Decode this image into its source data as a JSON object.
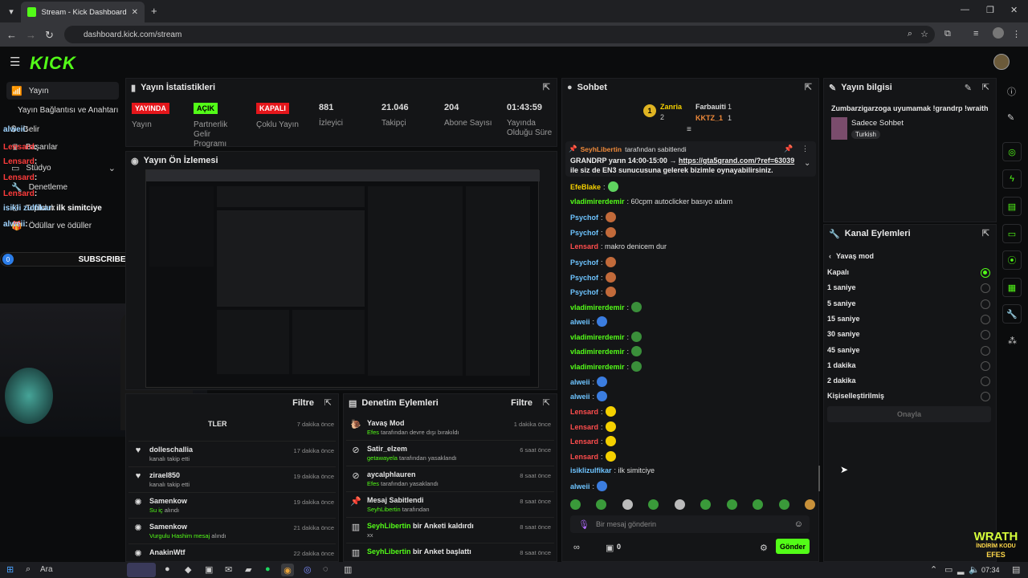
{
  "browser": {
    "tab_title": "Stream - Kick Dashboard",
    "url": "dashboard.kick.com/stream"
  },
  "kick": {
    "logo": "KICK"
  },
  "sidebar": {
    "items": [
      {
        "label": "Yayın"
      },
      {
        "label": "Yayın Bağlantısı ve Anahtarı"
      },
      {
        "label": "Gelir"
      },
      {
        "label": "Başarılar"
      },
      {
        "label": "Stüdyo"
      },
      {
        "label": "Denetleme"
      },
      {
        "label": "Topluluk"
      },
      {
        "label": "Ödüllar ve ödüller"
      }
    ]
  },
  "stats_panel": {
    "title": "Yayın İstatistikleri",
    "items": [
      {
        "badge": "YAYINDA",
        "label": "Yayın"
      },
      {
        "badge": "AÇIK",
        "label": "Partnerlik Gelir Programı"
      },
      {
        "badge": "KAPALI",
        "label": "Çoklu Yayın"
      },
      {
        "value": "881",
        "label": "İzleyici"
      },
      {
        "value": "21.046",
        "label": "Takipçi"
      },
      {
        "value": "204",
        "label": "Abone Sayısı"
      },
      {
        "value": "01:43:59",
        "label": "Yayında Olduğu Süre"
      }
    ]
  },
  "preview_panel": {
    "title": "Yayın Ön İzlemesi"
  },
  "overlay": {
    "subs_label": "SUBSCRIBERS",
    "subs_left": "0",
    "subs_right": "7",
    "chat_lines": [
      {
        "user": "alweii",
        "text": ":"
      },
      {
        "user": "Lensard",
        "text": ":"
      },
      {
        "user": "Lensard",
        "text": ":"
      },
      {
        "user": "Lensard",
        "text": ":"
      },
      {
        "user": "Lensard",
        "text": ":"
      },
      {
        "user": "isikli zulfikar",
        "text": ": ilk simitciye"
      },
      {
        "user": "alweii",
        "text": ":"
      }
    ]
  },
  "activity": {
    "filter": "Filtre",
    "header_cut": "TLER",
    "items": [
      {
        "time": "7 dakika önce"
      },
      {
        "title": "dolleschallia",
        "sub": "kanalı takip etti",
        "time": "17 dakika önce"
      },
      {
        "title": "zirael850",
        "sub": "kanalı takip etti",
        "time": "19 dakika önce"
      },
      {
        "title": "Samenkow",
        "sub_hl": "Su iç",
        "sub": "alındı",
        "time": "19 dakika önce"
      },
      {
        "title": "Samenkow",
        "sub_hl": "Vurgulu Hashim mesaj",
        "sub": "alındı",
        "time": "21 dakika önce"
      },
      {
        "title": "AnakinWtf",
        "time": "22 dakika önce"
      }
    ]
  },
  "mod_actions": {
    "title": "Denetim Eylemleri",
    "filter": "Filtre",
    "items": [
      {
        "title": "Yavaş Mod",
        "sub_hl": "Efes",
        "sub": "tarafından devre dışı bırakıldı",
        "time": "1 dakika önce"
      },
      {
        "title": "Satir_elzem",
        "sub_hl": "getawayela",
        "sub": "tarafından yasaklandı",
        "time": "6 saat önce"
      },
      {
        "title": "aycalphlauren",
        "sub_hl": "Efes",
        "sub": "tarafından yasaklandı",
        "time": "8 saat önce"
      },
      {
        "title": "Mesaj Sabitlendi",
        "sub_hl": "SeyhLibertin",
        "sub": "tarafından",
        "time": "8 saat önce"
      },
      {
        "title_hl": "SeyhLibertin",
        "title": "bir Anketi kaldırdı",
        "sub": "xx",
        "time": "8 saat önce"
      },
      {
        "title_hl": "SeyhLibertin",
        "title": "bir Anket başlattı",
        "time": "8 saat önce"
      }
    ]
  },
  "chat": {
    "title": "Sohbet",
    "leaders": [
      {
        "name": "Zanria",
        "count": "2"
      },
      {
        "name": "Farbauiti",
        "count": "1"
      },
      {
        "name": "KKTZ_1",
        "count": "1"
      }
    ],
    "pinned_by": "SeyhLibertin",
    "pinned_suffix": "tarafından sabitlendi",
    "pinned_text1": "GRANDRP yarın 14:00-15:00 →",
    "pinned_link": "https://gta5grand.com/?ref=63039",
    "pinned_text2": "ile siz de EN3 sunucusuna gelerek bizimle oynayabilirsiniz.",
    "messages": [
      {
        "user": "EfeBlake",
        "text": ":",
        "color": "#f5d000",
        "emo": "#5fd35f"
      },
      {
        "user": "vladimirerdemir",
        "text": ": 60cpm autoclicker basıyo adam",
        "color": "#53fc18",
        "emo": ""
      },
      {
        "user": "Psychof",
        "text": ":",
        "color": "#6ec4ff",
        "emo": "#c26a3a"
      },
      {
        "user": "Psychof",
        "text": ":",
        "color": "#6ec4ff",
        "emo": "#c26a3a"
      },
      {
        "user": "Lensard",
        "text": ": makro denicem dur",
        "color": "#ff4d4d",
        "emo": ""
      },
      {
        "user": "Psychof",
        "text": ":",
        "color": "#6ec4ff",
        "emo": "#c26a3a"
      },
      {
        "user": "Psychof",
        "text": ":",
        "color": "#6ec4ff",
        "emo": "#c26a3a"
      },
      {
        "user": "Psychof",
        "text": ":",
        "color": "#6ec4ff",
        "emo": "#c26a3a"
      },
      {
        "user": "vladimirerdemir",
        "text": ":",
        "color": "#53fc18",
        "emo": "#3a8f3a"
      },
      {
        "user": "alweii",
        "text": ":",
        "color": "#6ec4ff",
        "emo": "#3b7de0"
      },
      {
        "user": "vladimirerdemir",
        "text": ":",
        "color": "#53fc18",
        "emo": "#3a8f3a"
      },
      {
        "user": "vladimirerdemir",
        "text": ":",
        "color": "#53fc18",
        "emo": "#3a8f3a"
      },
      {
        "user": "vladimirerdemir",
        "text": ":",
        "color": "#53fc18",
        "emo": "#3a8f3a"
      },
      {
        "user": "alweii",
        "text": ":",
        "color": "#6ec4ff",
        "emo": "#3b7de0"
      },
      {
        "user": "alweii",
        "text": ":",
        "color": "#6ec4ff",
        "emo": "#3b7de0"
      },
      {
        "user": "Lensard",
        "text": ":",
        "color": "#ff4d4d",
        "emo": "#f5d000"
      },
      {
        "user": "Lensard",
        "text": ":",
        "color": "#ff4d4d",
        "emo": "#f5d000"
      },
      {
        "user": "Lensard",
        "text": ":",
        "color": "#ff4d4d",
        "emo": "#f5d000"
      },
      {
        "user": "Lensard",
        "text": ":",
        "color": "#ff4d4d",
        "emo": "#f5d000"
      },
      {
        "user": "isiklizulfikar",
        "text": ": ilk simitciye",
        "color": "#6ec4ff",
        "emo": ""
      },
      {
        "user": "alweii",
        "text": ":",
        "color": "#6ec4ff",
        "emo": "#3b7de0"
      }
    ],
    "input_placeholder": "Bir mesaj gönderin",
    "send_label": "Gönder",
    "points": "0"
  },
  "info_panel": {
    "title": "Yayın bilgisi",
    "stream_title": "Zumbarzigarzoga uyumamak !grandrp !wraith",
    "category": "Sadece Sohbet",
    "tag": "Turkish"
  },
  "channel_actions": {
    "title": "Kanal Eylemleri",
    "back_label": "Yavaş mod",
    "options": [
      "Kapalı",
      "1 saniye",
      "5 saniye",
      "15 saniye",
      "30 saniye",
      "45 saniye",
      "1 dakika",
      "2 dakika",
      "Kişiselleştirilmiş"
    ],
    "selected": "Kapalı",
    "confirm": "Onayla"
  },
  "taskbar": {
    "search": "Ara",
    "time": "07:34"
  },
  "watermark": {
    "line1": "WRATH",
    "line2": "İNDİRİM KODU",
    "line3": "EFES"
  }
}
